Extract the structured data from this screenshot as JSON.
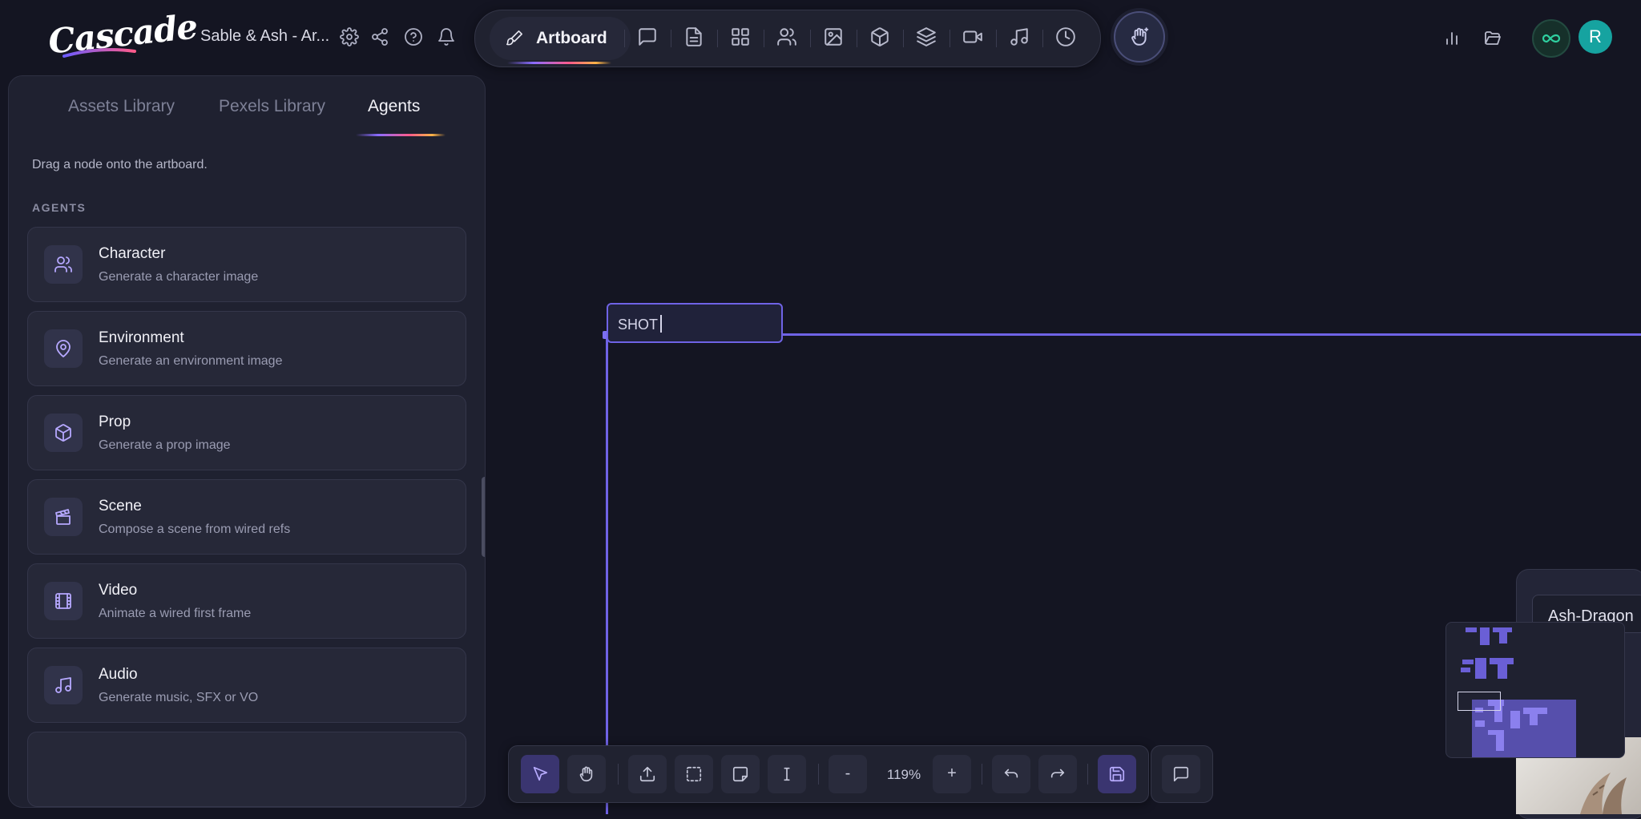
{
  "app": {
    "logo_text": "Cascade",
    "project_title": "Sable & Ash - Ar..."
  },
  "main_toolbar": {
    "active_label": "Artboard",
    "buttons": [
      "chat-icon",
      "document-icon",
      "grid-icon",
      "users-icon",
      "image-icon",
      "cube-icon",
      "layers-icon",
      "video-icon",
      "music-icon",
      "history-icon"
    ]
  },
  "panel": {
    "tabs": [
      "Assets Library",
      "Pexels Library",
      "Agents"
    ],
    "active_tab": "Agents",
    "hint": "Drag a node onto the artboard.",
    "section_label": "AGENTS",
    "agents": [
      {
        "title": "Character",
        "desc": "Generate a character image",
        "icon": "users-icon"
      },
      {
        "title": "Environment",
        "desc": "Generate an environment image",
        "icon": "map-pin-icon"
      },
      {
        "title": "Prop",
        "desc": "Generate a prop image",
        "icon": "cube-icon"
      },
      {
        "title": "Scene",
        "desc": "Compose a scene from wired refs",
        "icon": "clapperboard-icon"
      },
      {
        "title": "Video",
        "desc": "Animate a wired first frame",
        "icon": "film-icon"
      },
      {
        "title": "Audio",
        "desc": "Generate music, SFX or VO",
        "icon": "music-icon"
      }
    ]
  },
  "canvas": {
    "shot_label_value": "SHOT",
    "node_title": "Ash-Dragon"
  },
  "bottom_toolbar": {
    "zoom": "119%",
    "zoom_out": "-",
    "zoom_in": "+"
  },
  "user": {
    "avatar_initial": "R",
    "plan_symbol": "∞"
  },
  "colors": {
    "accent": "#6f63e6",
    "background": "#141522",
    "panel": "#1f2130",
    "avatar": "#16a3a0",
    "plan_badge": "#2fd0a0"
  }
}
